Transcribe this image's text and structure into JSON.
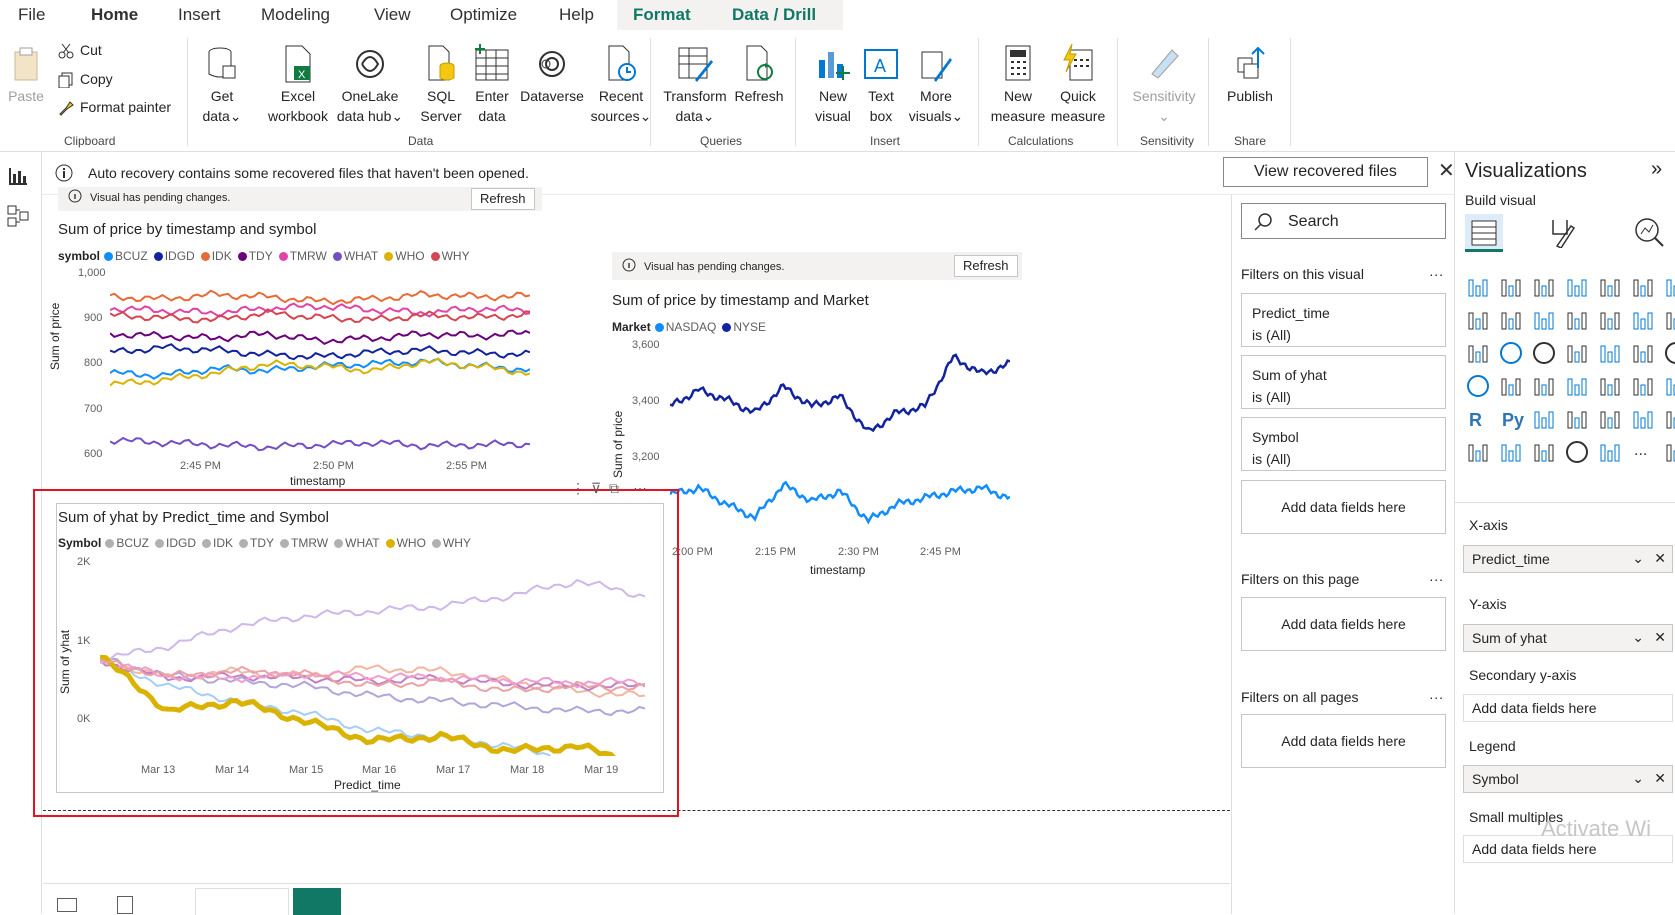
{
  "menu": {
    "file": "File",
    "home": "Home",
    "insert": "Insert",
    "modeling": "Modeling",
    "view": "View",
    "optimize": "Optimize",
    "help": "Help",
    "format": "Format",
    "data_drill": "Data / Drill"
  },
  "ribbon": {
    "paste": "Paste",
    "cut": "Cut",
    "copy": "Copy",
    "format_painter": "Format painter",
    "clipboard": "Clipboard",
    "get_data": [
      "Get",
      "data"
    ],
    "excel": [
      "Excel",
      "workbook"
    ],
    "onelake": [
      "OneLake",
      "data hub"
    ],
    "sql": [
      "SQL",
      "Server"
    ],
    "enter": [
      "Enter",
      "data"
    ],
    "dataverse": "Dataverse",
    "recent": [
      "Recent",
      "sources"
    ],
    "data_group": "Data",
    "transform": [
      "Transform",
      "data"
    ],
    "refresh": "Refresh",
    "queries": "Queries",
    "new_visual": [
      "New",
      "visual"
    ],
    "text_box": [
      "Text",
      "box"
    ],
    "more_visuals": [
      "More",
      "visuals"
    ],
    "insert_group": "Insert",
    "new_measure": [
      "New",
      "measure"
    ],
    "quick_measure": [
      "Quick",
      "measure"
    ],
    "calculations": "Calculations",
    "sensitivity_btn": "Sensitivity",
    "sensitivity": "Sensitivity",
    "publish": "Publish",
    "share": "Share"
  },
  "notification": {
    "text": "Auto recovery contains some recovered files that haven't been opened.",
    "button": "View recovered files"
  },
  "visual1": {
    "pending": "Visual has pending changes.",
    "refresh": "Refresh",
    "title": "Sum of price by timestamp and symbol",
    "legend_title": "symbol",
    "yticks": [
      "1,000",
      "900",
      "800",
      "700",
      "600"
    ],
    "xticks": [
      "2:45 PM",
      "2:50 PM",
      "2:55 PM"
    ],
    "xlabel": "timestamp",
    "ylabel": "Sum of price"
  },
  "visual2": {
    "pending": "Visual has pending changes.",
    "refresh": "Refresh",
    "title": "Sum of price by timestamp and Market",
    "legend_title": "Market",
    "yticks": [
      "3,600",
      "3,400",
      "3,200"
    ],
    "xticks": [
      "2:00 PM",
      "2:15 PM",
      "2:30 PM",
      "2:45 PM"
    ],
    "xlabel": "timestamp",
    "ylabel": "Sum of price"
  },
  "visual3": {
    "title": "Sum of yhat by Predict_time and Symbol",
    "legend_title": "Symbol",
    "yticks": [
      "2K",
      "1K",
      "0K"
    ],
    "xticks": [
      "Mar 13",
      "Mar 14",
      "Mar 15",
      "Mar 16",
      "Mar 17",
      "Mar 18",
      "Mar 19"
    ],
    "xlabel": "Predict_time",
    "ylabel": "Sum of yhat"
  },
  "chart_data": [
    {
      "type": "line",
      "title": "Sum of price by timestamp and symbol",
      "xlabel": "timestamp",
      "ylabel": "Sum of price",
      "ylim": [
        600,
        1000
      ],
      "x": [
        "2:42 PM",
        "2:44 PM",
        "2:46 PM",
        "2:48 PM",
        "2:50 PM",
        "2:52 PM",
        "2:54 PM",
        "2:56 PM",
        "2:58 PM"
      ],
      "series": [
        {
          "name": "BCUZ",
          "color": "#118dff",
          "values": [
            775,
            770,
            785,
            780,
            790,
            795,
            800,
            790,
            782
          ]
        },
        {
          "name": "IDGD",
          "color": "#12239e",
          "values": [
            820,
            830,
            825,
            815,
            810,
            820,
            825,
            818,
            815
          ]
        },
        {
          "name": "IDK",
          "color": "#e66c37",
          "values": [
            940,
            935,
            945,
            940,
            930,
            935,
            945,
            940,
            942
          ]
        },
        {
          "name": "TDY",
          "color": "#6b007b",
          "values": [
            860,
            855,
            850,
            860,
            845,
            850,
            860,
            855,
            862
          ]
        },
        {
          "name": "TMRW",
          "color": "#e044a7",
          "values": [
            915,
            910,
            905,
            915,
            920,
            912,
            905,
            915,
            910
          ]
        },
        {
          "name": "WHAT",
          "color": "#744ec2",
          "values": [
            630,
            625,
            620,
            615,
            620,
            625,
            618,
            620,
            622
          ]
        },
        {
          "name": "WHO",
          "color": "#d9b300",
          "values": [
            750,
            760,
            775,
            795,
            790,
            780,
            800,
            790,
            775
          ]
        },
        {
          "name": "WHY",
          "color": "#d64550",
          "values": [
            900,
            895,
            890,
            905,
            895,
            890,
            900,
            895,
            902
          ]
        }
      ]
    },
    {
      "type": "line",
      "title": "Sum of price by timestamp and Market",
      "xlabel": "timestamp",
      "ylabel": "Sum of price",
      "ylim": [
        3000,
        3600
      ],
      "x": [
        "1:55 PM",
        "2:00 PM",
        "2:05 PM",
        "2:10 PM",
        "2:15 PM",
        "2:20 PM",
        "2:25 PM",
        "2:30 PM",
        "2:35 PM",
        "2:40 PM",
        "2:45 PM",
        "2:50 PM",
        "2:55 PM"
      ],
      "series": [
        {
          "name": "NASDAQ",
          "color": "#118dff",
          "values": [
            3130,
            3150,
            3100,
            3060,
            3160,
            3110,
            3140,
            3050,
            3100,
            3120,
            3140,
            3150,
            3120
          ]
        },
        {
          "name": "NYSE",
          "color": "#12239e",
          "values": [
            3400,
            3450,
            3420,
            3380,
            3460,
            3400,
            3430,
            3320,
            3380,
            3400,
            3550,
            3500,
            3530
          ]
        }
      ]
    },
    {
      "type": "line",
      "title": "Sum of yhat by Predict_time and Symbol",
      "xlabel": "Predict_time",
      "ylabel": "Sum of yhat",
      "ylim": [
        0,
        2000
      ],
      "x": [
        "Mar 12",
        "Mar 13",
        "Mar 14",
        "Mar 15",
        "Mar 16",
        "Mar 17",
        "Mar 18",
        "Mar 19",
        "Mar 19.5"
      ],
      "series": [
        {
          "name": "BCUZ",
          "color": "#a6cdf5",
          "values": [
            950,
            700,
            550,
            430,
            250,
            200,
            100,
            -50,
            -250
          ]
        },
        {
          "name": "IDGD",
          "color": "#b3a4d9",
          "values": [
            980,
            800,
            750,
            700,
            600,
            550,
            500,
            450,
            450
          ]
        },
        {
          "name": "IDK",
          "color": "#f2b7a0",
          "values": [
            960,
            780,
            850,
            800,
            880,
            850,
            750,
            650,
            600
          ]
        },
        {
          "name": "TDY",
          "color": "#c37fc4",
          "values": [
            950,
            780,
            800,
            780,
            750,
            780,
            720,
            700,
            700
          ]
        },
        {
          "name": "TMRW",
          "color": "#ef9fcf",
          "values": [
            950,
            800,
            780,
            820,
            800,
            780,
            760,
            730,
            750
          ]
        },
        {
          "name": "WHAT",
          "color": "#cdb8ea",
          "values": [
            960,
            1100,
            1300,
            1400,
            1450,
            1500,
            1600,
            1750,
            1600
          ]
        },
        {
          "name": "WHO",
          "color": "#d9b300",
          "values": [
            1000,
            450,
            550,
            350,
            150,
            200,
            50,
            100,
            -100
          ]
        },
        {
          "name": "WHY",
          "color": "#eaa2a7",
          "values": [
            950,
            800,
            850,
            820,
            700,
            750,
            650,
            700,
            680
          ]
        }
      ]
    }
  ],
  "filters": {
    "search": "Search",
    "on_visual": "Filters on this visual",
    "card1": [
      "Predict_time",
      "is (All)"
    ],
    "card2": [
      "Sum of yhat",
      "is (All)"
    ],
    "card3": [
      "Symbol",
      "is (All)"
    ],
    "add_fields": "Add data fields here",
    "on_page": "Filters on this page",
    "on_all": "Filters on all pages",
    "more": "..."
  },
  "viz": {
    "title": "Visualizations",
    "build": "Build visual",
    "xaxis": "X-axis",
    "xaxis_val": "Predict_time",
    "yaxis": "Y-axis",
    "yaxis_val": "Sum of yhat",
    "secondary": "Secondary y-axis",
    "secondary_val": "Add data fields here",
    "legend": "Legend",
    "legend_val": "Symbol",
    "small_multiples": "Small multiples",
    "small_val": "Add data fields here",
    "watermark": "Activate Wi",
    "r_icon": "R",
    "py_icon": "Py",
    "more_icon": "..."
  },
  "colors": {
    "accent": "#117865",
    "selection": "#e81123"
  }
}
